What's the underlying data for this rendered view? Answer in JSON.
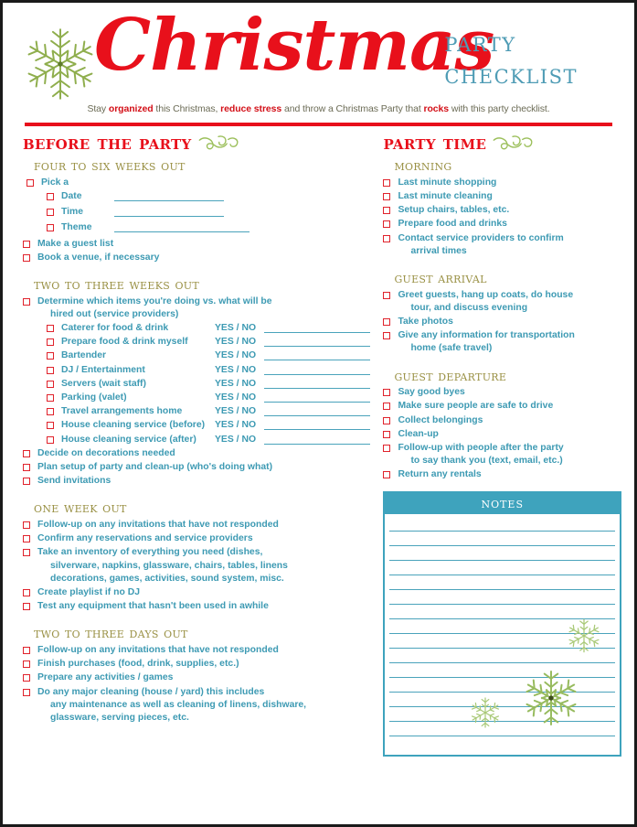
{
  "document": {
    "title_script": "Christmas",
    "title_line1": "Party",
    "title_line2": "Checklist",
    "subtitle": {
      "p1": "Stay ",
      "b1": "organized",
      "p2": " this Christmas, ",
      "b2": "reduce stress",
      "p3": " and throw a Christmas Party that ",
      "b3": "rocks",
      "p4": " with this party checklist."
    }
  },
  "colors": {
    "red": "#e8101b",
    "teal": "#3d9ab3",
    "olive": "#9a9145",
    "green": "#9bbf5a",
    "notes_header": "#3ea3bd",
    "checkbox_border": "#e0222b"
  },
  "left_column": {
    "heading": "Before the Party",
    "sections": [
      {
        "title": "Four to Six Weeks Out",
        "items": [
          {
            "level": 1,
            "text": "Pick a"
          },
          {
            "level": 2,
            "text": "Date",
            "fill": "short"
          },
          {
            "level": 2,
            "text": "Time",
            "fill": "short"
          },
          {
            "level": 2,
            "text": "Theme",
            "fill": "long"
          },
          {
            "level": 1,
            "text": "Make a guest list"
          },
          {
            "level": 1,
            "text": "Book a venue, if necessary"
          }
        ]
      },
      {
        "title": "Two to Three Weeks Out",
        "items": [
          {
            "level": 1,
            "text": "Determine which items you're doing vs. what will be",
            "cont": "hired out (service providers)"
          }
        ],
        "yesno_label": "YES / NO",
        "yesno_items": [
          "Caterer for food & drink",
          "Prepare food & drink myself",
          "Bartender",
          "DJ / Entertainment",
          "Servers (wait staff)",
          "Parking (valet)",
          "Travel arrangements home",
          "House cleaning service (before)",
          "House cleaning service (after)"
        ],
        "items_after": [
          {
            "level": 1,
            "text": "Decide on decorations needed"
          },
          {
            "level": 1,
            "text": "Plan setup of party and clean-up (who's doing what)"
          },
          {
            "level": 1,
            "text": "Send invitations"
          }
        ]
      },
      {
        "title": "One Week Out",
        "items": [
          {
            "level": 1,
            "text": "Follow-up on any invitations that have not responded"
          },
          {
            "level": 1,
            "text": "Confirm any reservations and service providers"
          },
          {
            "level": 1,
            "text": "Take an inventory of everything you need (dishes,",
            "cont": "silverware, napkins, glassware,  chairs, tables, linens",
            "cont2": "decorations, games, activities, sound system, misc."
          },
          {
            "level": 1,
            "text": "Create playlist if no DJ"
          },
          {
            "level": 1,
            "text": "Test any equipment that hasn't been used in awhile"
          }
        ]
      },
      {
        "title": "Two to Three Days Out",
        "items": [
          {
            "level": 1,
            "text": "Follow-up on any invitations that have not responded"
          },
          {
            "level": 1,
            "text": "Finish purchases (food, drink, supplies, etc.)"
          },
          {
            "level": 1,
            "text": "Prepare any activities / games"
          },
          {
            "level": 1,
            "text": "Do any major cleaning (house / yard) this includes",
            "cont": "any maintenance as well as cleaning of linens, dishware,",
            "cont2": "glassware, serving pieces, etc."
          }
        ]
      }
    ]
  },
  "right_column": {
    "heading": "Party Time",
    "sections": [
      {
        "title": "Morning",
        "items": [
          {
            "level": 1,
            "text": "Last minute shopping"
          },
          {
            "level": 1,
            "text": "Last minute cleaning"
          },
          {
            "level": 1,
            "text": "Setup chairs, tables, etc."
          },
          {
            "level": 1,
            "text": "Prepare food and drinks"
          },
          {
            "level": 1,
            "text": "Contact service providers to confirm",
            "cont": "arrival times"
          }
        ]
      },
      {
        "title": "Guest Arrival",
        "items": [
          {
            "level": 1,
            "text": "Greet guests, hang up coats, do house",
            "cont": "tour, and discuss evening"
          },
          {
            "level": 1,
            "text": "Take photos"
          },
          {
            "level": 1,
            "text": "Give any information for transportation",
            "cont": "home (safe travel)"
          }
        ]
      },
      {
        "title": "Guest Departure",
        "items": [
          {
            "level": 1,
            "text": "Say good byes"
          },
          {
            "level": 1,
            "text": "Make sure people are safe to drive"
          },
          {
            "level": 1,
            "text": "Collect belongings"
          },
          {
            "level": 1,
            "text": "Clean-up"
          },
          {
            "level": 1,
            "text": "Follow-up with people after the party",
            "cont": "to say thank you (text, email, etc.)"
          },
          {
            "level": 1,
            "text": "Return any rentals"
          }
        ]
      }
    ],
    "notes": {
      "title": "Notes",
      "line_count": 16
    }
  }
}
